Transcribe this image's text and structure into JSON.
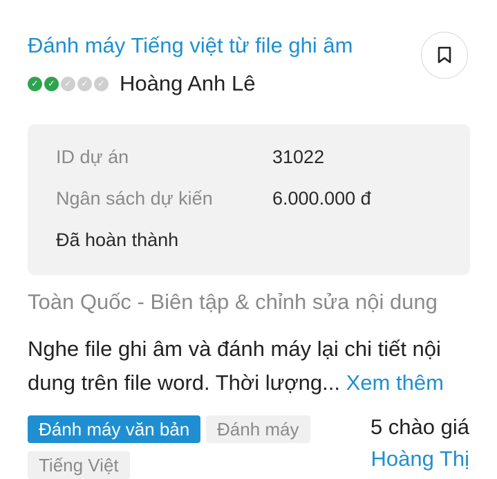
{
  "project": {
    "title": "Đánh máy Tiếng việt từ file ghi âm",
    "owner_name": "Hoàng Anh Lê",
    "rating": {
      "achieved": 2,
      "total": 5
    }
  },
  "info": {
    "id_label": "ID dự án",
    "id_value": "31022",
    "budget_label": "Ngân sách dự kiến",
    "budget_value": "6.000.000 đ",
    "status": "Đã hoàn thành"
  },
  "category_line": "Toàn Quốc - Biên tập & chỉnh sửa nội dung",
  "description": {
    "text": "Nghe file ghi âm và đánh máy lại chi tiết nội dung trên file word. Thời lượng...",
    "more_link": "Xem thêm"
  },
  "tags": [
    {
      "label": "Đánh máy văn bản",
      "active": true
    },
    {
      "label": "Đánh máy",
      "active": false
    },
    {
      "label": "Tiếng Việt",
      "active": false
    }
  ],
  "bids": {
    "count_label": "5 chào giá",
    "bidder_name": "Hoàng Thị"
  },
  "icons": {
    "bookmark": "bookmark-icon",
    "verified": "check-badge-icon"
  },
  "colors": {
    "accent": "#1f8fd1",
    "badge_active": "#2ea44f",
    "badge_inactive": "#cfcfcf",
    "muted_text": "#8a8a8a",
    "info_background": "#f2f2f2"
  }
}
